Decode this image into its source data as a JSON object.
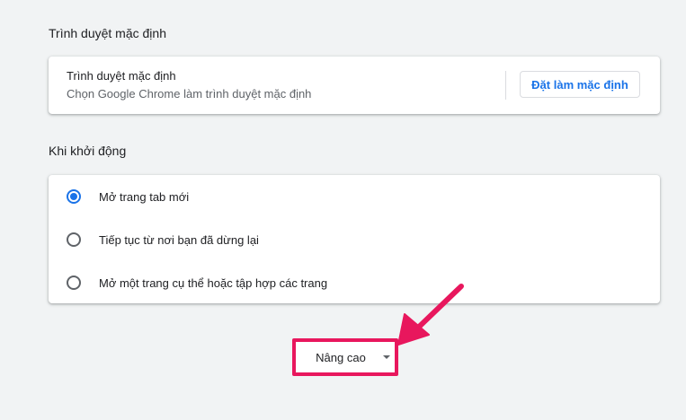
{
  "default_browser": {
    "section_title": "Trình duyệt mặc định",
    "primary_text": "Trình duyệt mặc định",
    "secondary_text": "Chọn Google Chrome làm trình duyệt mặc định",
    "button_label": "Đặt làm mặc định"
  },
  "on_startup": {
    "section_title": "Khi khởi động",
    "options": [
      {
        "label": "Mở trang tab mới",
        "checked": true
      },
      {
        "label": "Tiếp tục từ nơi bạn đã dừng lại",
        "checked": false
      },
      {
        "label": "Mở một trang cụ thể hoặc tập hợp các trang",
        "checked": false
      }
    ]
  },
  "advanced": {
    "label": "Nâng cao"
  },
  "colors": {
    "accent": "#1a73e8",
    "annotation": "#e8175d",
    "background": "#f1f3f4"
  },
  "icons": {
    "advanced_caret": "caret-down-icon",
    "annotation_arrow": "arrow-icon"
  }
}
